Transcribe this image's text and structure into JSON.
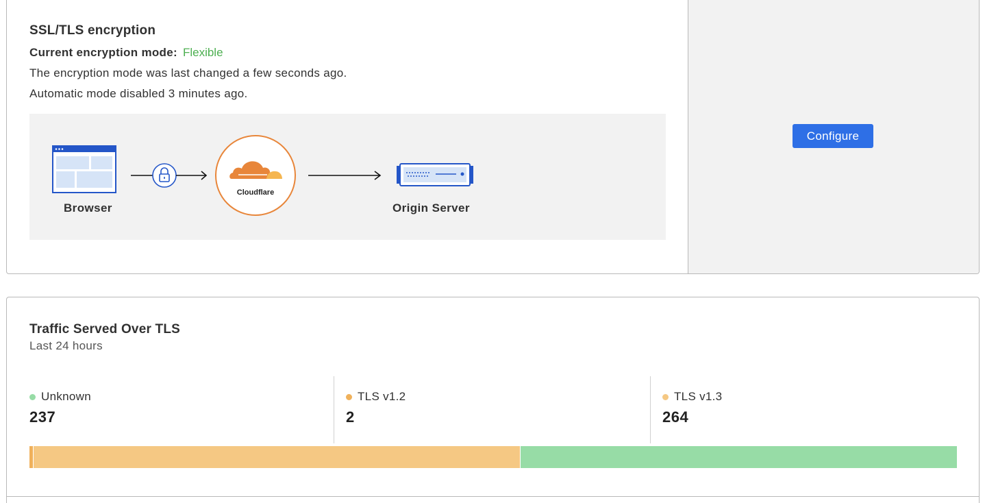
{
  "encryption": {
    "title": "SSL/TLS encryption",
    "mode_label": "Current encryption mode:",
    "mode_value": "Flexible",
    "last_changed": "The encryption mode was last changed a few seconds ago.",
    "automatic_note": "Automatic mode disabled 3 minutes ago.",
    "diagram": {
      "browser_label": "Browser",
      "cloudflare_label": "Cloudflare",
      "origin_label": "Origin Server",
      "icons": [
        "browser-window-icon",
        "padlock-icon",
        "cloudflare-cloud-icon",
        "origin-server-icon"
      ]
    },
    "configure_label": "Configure"
  },
  "traffic": {
    "title": "Traffic Served Over TLS",
    "subtitle": "Last 24 hours",
    "stats": [
      {
        "label": "Unknown",
        "value": "237",
        "color": "#97dca6"
      },
      {
        "label": "TLS v1.2",
        "value": "2",
        "color": "#f0b15b"
      },
      {
        "label": "TLS v1.3",
        "value": "264",
        "color": "#f5c883"
      }
    ],
    "bar_segments": [
      {
        "name": "TLS v1.2",
        "share": 0.004,
        "color": "#f0b15b"
      },
      {
        "name": "TLS v1.3",
        "share": 0.525,
        "color": "#f5c883"
      },
      {
        "name": "Unknown",
        "share": 0.471,
        "color": "#97dca6"
      }
    ]
  },
  "colors": {
    "accent": "#2e6fe6",
    "flexible": "#4caf50",
    "cloudflare_orange": "#e8863a"
  }
}
